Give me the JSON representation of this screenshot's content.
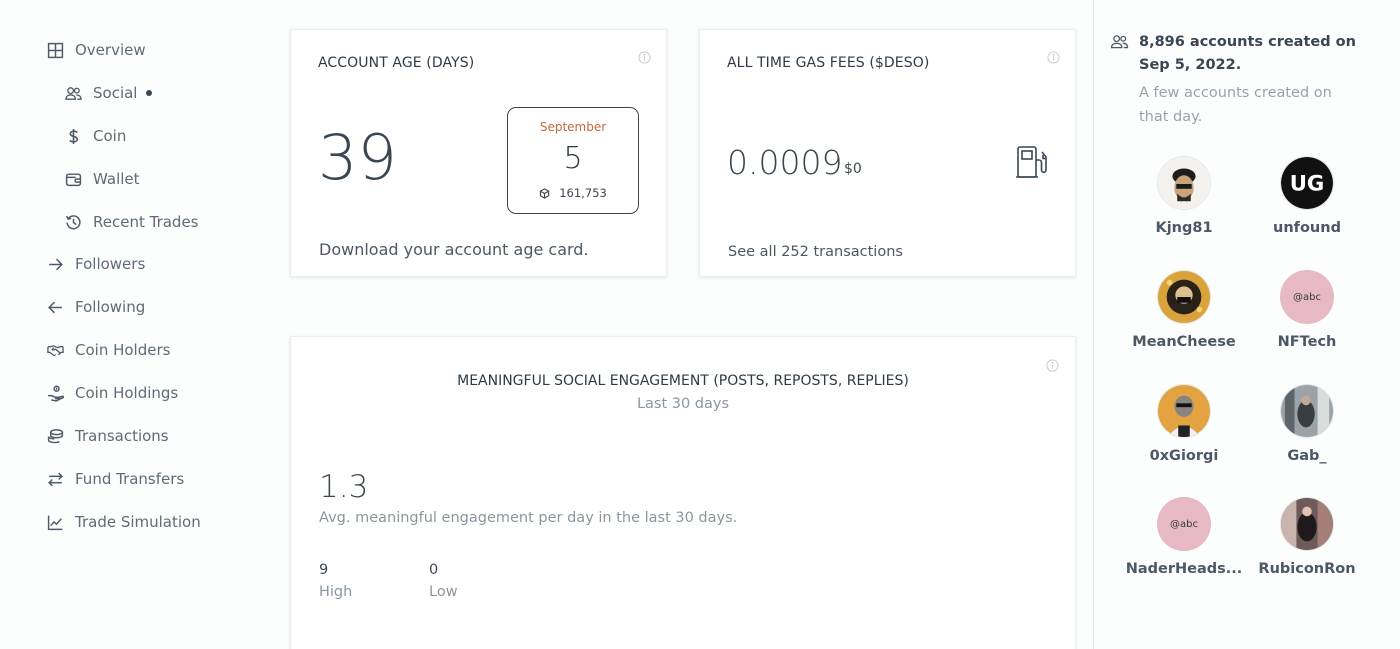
{
  "sidebar": {
    "items": [
      {
        "label": "Overview",
        "icon": "grid-icon"
      },
      {
        "label": "Social",
        "icon": "users-icon"
      },
      {
        "label": "Coin",
        "icon": "dollar-icon"
      },
      {
        "label": "Wallet",
        "icon": "wallet-icon"
      },
      {
        "label": "Recent Trades",
        "icon": "history-icon"
      },
      {
        "label": "Followers",
        "icon": "arrow-right-icon"
      },
      {
        "label": "Following",
        "icon": "arrow-left-icon"
      },
      {
        "label": "Coin Holders",
        "icon": "handshake-icon"
      },
      {
        "label": "Coin Holdings",
        "icon": "hand-coin-icon"
      },
      {
        "label": "Transactions",
        "icon": "coins-stack-icon"
      },
      {
        "label": "Fund Transfers",
        "icon": "swap-arrows-icon"
      },
      {
        "label": "Trade Simulation",
        "icon": "line-chart-icon"
      }
    ]
  },
  "account_age": {
    "title": "ACCOUNT AGE (DAYS)",
    "value": "39",
    "calendar": {
      "month": "September",
      "day": "5",
      "block": "161,753"
    },
    "download_link": "Download your account age card."
  },
  "gas_fees": {
    "title": "ALL TIME GAS FEES ($DESO)",
    "value": "0.0009",
    "usd": "$0",
    "see_all_link": "See all 252 transactions"
  },
  "engagement": {
    "title": "MEANINGFUL SOCIAL ENGAGEMENT (POSTS, REPOSTS, REPLIES)",
    "subtitle": "Last 30 days",
    "value": "1.3",
    "caption": "Avg. meaningful engagement per day in the last 30 days.",
    "high_value": "9",
    "high_label": "High",
    "low_value": "0",
    "low_label": "Low"
  },
  "right_panel": {
    "title": "8,896 accounts created on Sep 5, 2022.",
    "subtitle": "A few accounts created on that day.",
    "accounts": [
      {
        "name": "Kjng81",
        "placeholder": ""
      },
      {
        "name": "unfound",
        "placeholder": ""
      },
      {
        "name": "MeanCheese",
        "placeholder": ""
      },
      {
        "name": "NFTech",
        "placeholder": "@abc"
      },
      {
        "name": "0xGiorgi",
        "placeholder": ""
      },
      {
        "name": "Gab_",
        "placeholder": ""
      },
      {
        "name": "NaderHeads...",
        "placeholder": "@abc"
      },
      {
        "name": "RubiconRon",
        "placeholder": ""
      }
    ]
  }
}
